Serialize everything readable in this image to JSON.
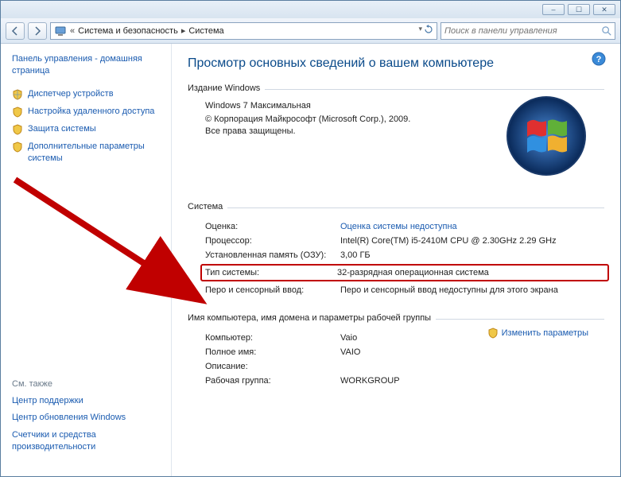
{
  "breadcrumb": {
    "seg1": "Система и безопасность",
    "seg2": "Система",
    "prefix": "«"
  },
  "search": {
    "placeholder": "Поиск в панели управления"
  },
  "sidebar": {
    "home": "Панель управления - домашняя страница",
    "links": [
      "Диспетчер устройств",
      "Настройка удаленного доступа",
      "Защита системы",
      "Дополнительные параметры системы"
    ],
    "seealso_title": "См. также",
    "seealso": [
      "Центр поддержки",
      "Центр обновления Windows",
      "Счетчики и средства производительности"
    ]
  },
  "main": {
    "title": "Просмотр основных сведений о вашем компьютере",
    "edition_heading": "Издание Windows",
    "edition_name": "Windows 7 Максимальная",
    "copyright": "© Корпорация Майкрософт (Microsoft Corp.), 2009. Все права защищены.",
    "system_heading": "Система",
    "rows": {
      "rating_label": "Оценка:",
      "rating_value": "Оценка системы недоступна",
      "cpu_label": "Процессор:",
      "cpu_value": "Intel(R) Core(TM) i5-2410M CPU @ 2.30GHz   2.29 GHz",
      "ram_label": "Установленная память (ОЗУ):",
      "ram_value": "3,00 ГБ",
      "type_label": "Тип системы:",
      "type_value": "32-разрядная операционная система",
      "pen_label": "Перо и сенсорный ввод:",
      "pen_value": "Перо и сенсорный ввод недоступны для этого экрана"
    },
    "group_heading": "Имя компьютера, имя домена и параметры рабочей группы",
    "group": {
      "pc_label": "Компьютер:",
      "pc_value": "Vaio",
      "full_label": "Полное имя:",
      "full_value": "VAIO",
      "desc_label": "Описание:",
      "desc_value": "",
      "wg_label": "Рабочая группа:",
      "wg_value": "WORKGROUP"
    },
    "change": "Изменить параметры"
  }
}
